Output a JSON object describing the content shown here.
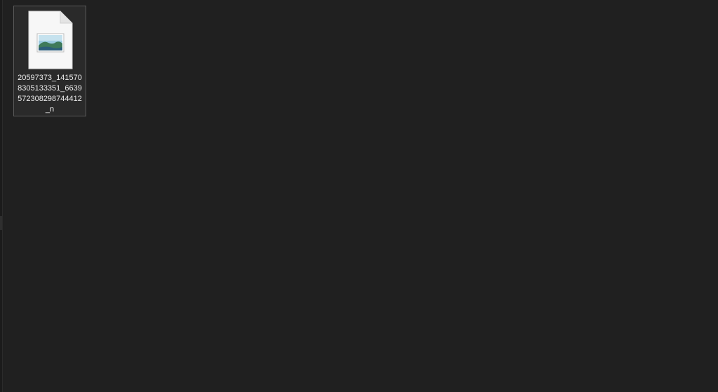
{
  "window": {
    "background": "#202020"
  },
  "files": [
    {
      "name": "20597373_1415708305133351_6639572308298744412_n",
      "icon": "image-file-icon",
      "selected": true
    }
  ]
}
